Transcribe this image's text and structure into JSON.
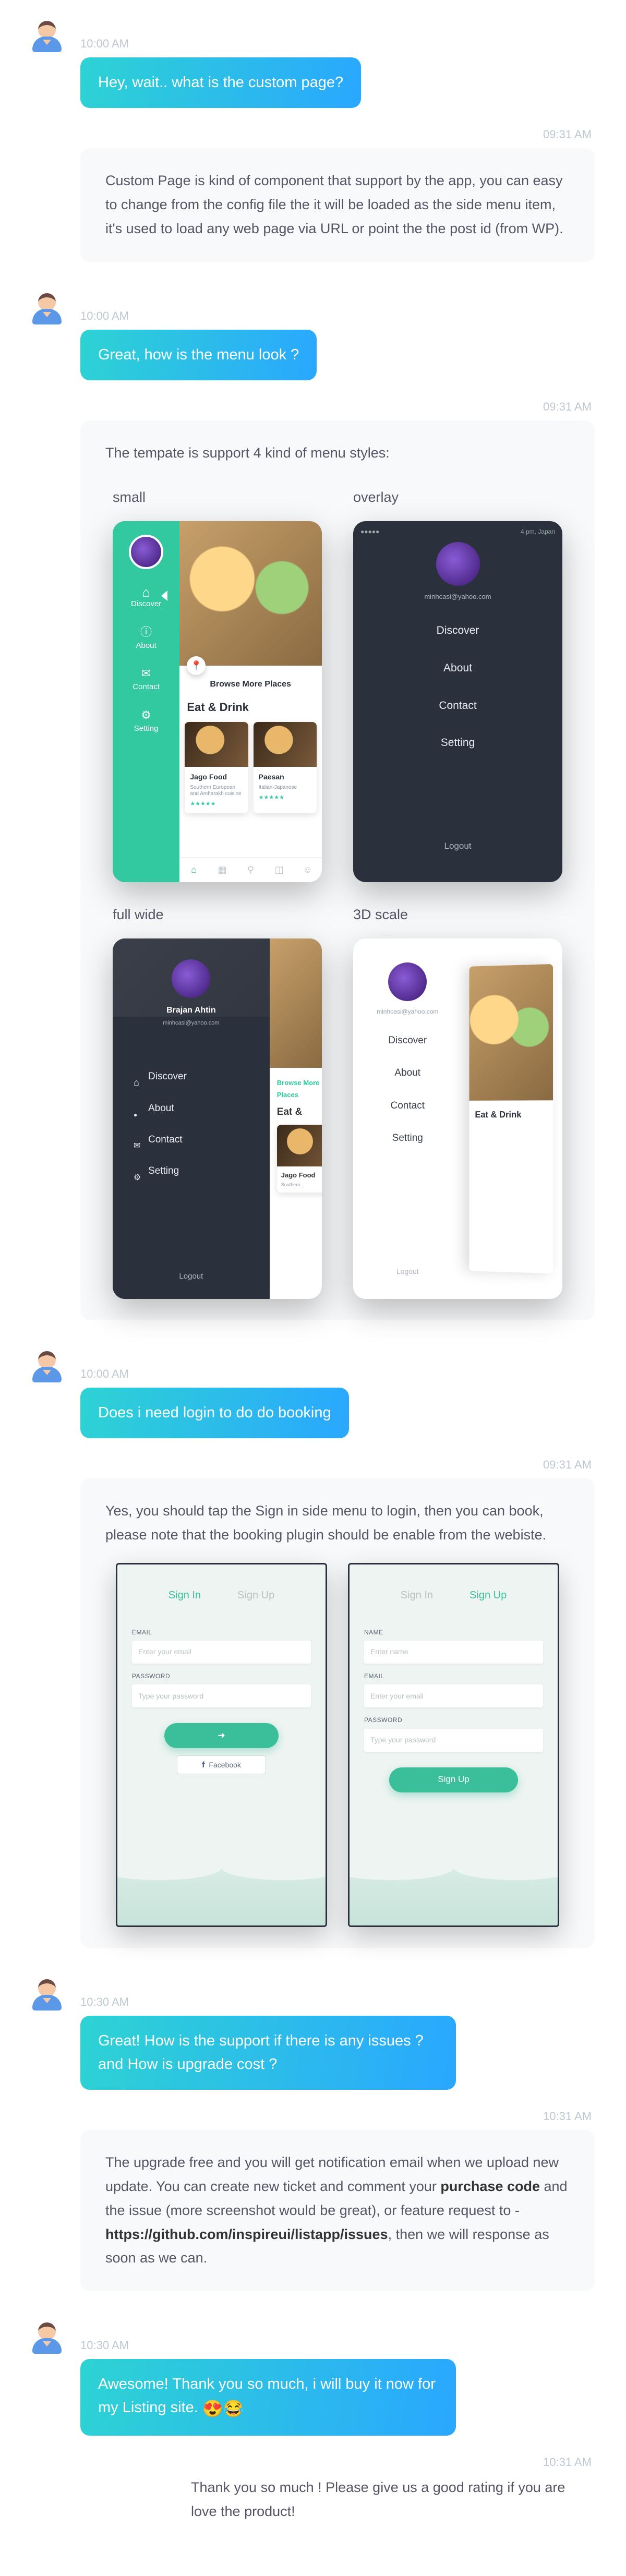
{
  "messages": [
    {
      "ts": "10:00 AM",
      "outgoing": "Hey, wait.. what is the custom page?",
      "reply_ts": "09:31 AM",
      "reply": "Custom Page is kind of component that support by the app, you can easy to change from the config file the it will be loaded as the side menu item, it's used to load any web page via URL or point the the post id (from WP)."
    },
    {
      "ts": "10:00 AM",
      "outgoing": "Great, how is the menu look ?",
      "reply_ts": "09:31 AM",
      "reply": "The tempate is support 4 kind of menu styles:"
    },
    {
      "ts": "10:00 AM",
      "outgoing": "Does i need login to do do booking",
      "reply_ts": "09:31 AM",
      "reply": "Yes, you should tap the Sign in side menu to login, then you can book, please note that the booking plugin should be enable from the webiste."
    },
    {
      "ts": "10:30 AM",
      "outgoing": "Great! How is the support if there is any issues ? and How is upgrade cost ?",
      "reply_ts": "10:31 AM",
      "reply_pre": "The upgrade free and you will get notification email when we upload new update. You can create new ticket and comment your ",
      "reply_bold1": "purchase code",
      "reply_mid": " and the issue (more screenshot would be great), or feature request to - ",
      "reply_bold2": "https://github.com/inspireui/listapp/issues",
      "reply_post": ", then we will response as soon as we can."
    },
    {
      "ts": "10:30 AM",
      "outgoing": "Awesome! Thank you so much, i will buy it now for my Listing site. ",
      "emoji": "😍😂",
      "reply_ts": "10:31 AM",
      "reply": "Thank you so much ! Please give us a good rating if you are love the product!"
    }
  ],
  "menu_styles": {
    "labels": {
      "small": "small",
      "overlay": "overlay",
      "full": "full wide",
      "scale": "3D scale"
    },
    "common": {
      "email": "minhcasi@yahoo.com",
      "name": "Brajan Ahtin",
      "items": {
        "discover": "Discover",
        "about": "About",
        "contact": "Contact",
        "setting": "Setting"
      },
      "logout": "Logout",
      "browse": "Browse More Places",
      "eat_drink": "Eat & Drink",
      "card1": {
        "title": "Jago Food",
        "sub": "Southern European and Amharakh cuisine"
      },
      "card2": {
        "title": "Paesan",
        "sub": "Italian-Japanese"
      },
      "statusbar": {
        "left": "●●●●●",
        "right": "4 pm, Japan"
      }
    }
  },
  "login": {
    "tabs": {
      "signin": "Sign In",
      "signup": "Sign Up"
    },
    "fields": {
      "email_label": "EMAIL",
      "email_ph": "Enter your email",
      "password_label": "PASSWORD",
      "password_ph": "Type your password",
      "name_label": "NAME",
      "name_ph": "Enter name"
    },
    "fb": "Facebook"
  }
}
